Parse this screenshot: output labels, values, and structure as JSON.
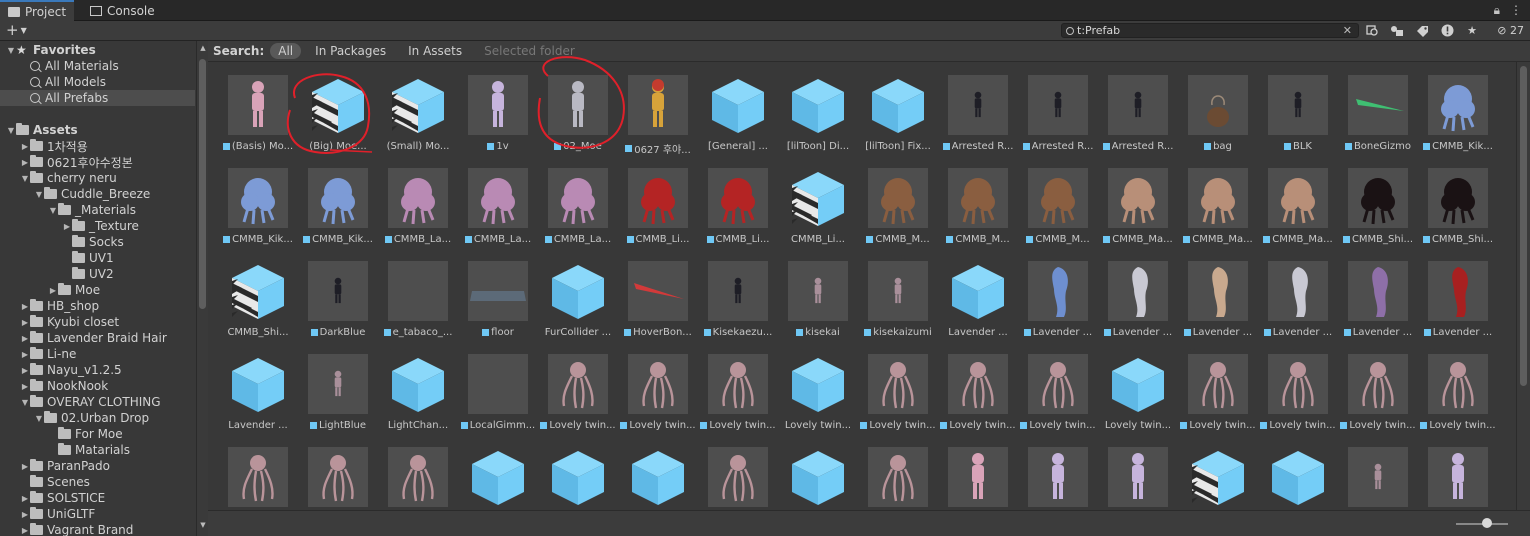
{
  "tabs": [
    {
      "label": "Project",
      "icon": "folder-icon",
      "active": true
    },
    {
      "label": "Console",
      "icon": "console-icon",
      "active": false
    }
  ],
  "toolbar": {
    "add_label": "+",
    "search_value": "t:Prefab",
    "hidden_count": "27"
  },
  "sidebar": {
    "items": [
      {
        "label": "Favorites",
        "depth": 0,
        "expanded": true,
        "kind": "star",
        "bold": true
      },
      {
        "label": "All Materials",
        "depth": 1,
        "kind": "search"
      },
      {
        "label": "All Models",
        "depth": 1,
        "kind": "search"
      },
      {
        "label": "All Prefabs",
        "depth": 1,
        "kind": "search",
        "selected": true
      },
      {
        "label": "Assets",
        "depth": 0,
        "expanded": true,
        "kind": "folder",
        "bold": true
      },
      {
        "label": "1차적용",
        "depth": 1,
        "expanded": false,
        "kind": "folder"
      },
      {
        "label": "0621후야수정본",
        "depth": 1,
        "expanded": false,
        "kind": "folder"
      },
      {
        "label": "cherry neru",
        "depth": 1,
        "expanded": true,
        "kind": "folder"
      },
      {
        "label": "Cuddle_Breeze",
        "depth": 2,
        "expanded": true,
        "kind": "folder"
      },
      {
        "label": "_Materials",
        "depth": 3,
        "expanded": true,
        "kind": "folder"
      },
      {
        "label": "_Texture",
        "depth": 4,
        "expanded": false,
        "kind": "folder"
      },
      {
        "label": "Socks",
        "depth": 4,
        "kind": "folder"
      },
      {
        "label": "UV1",
        "depth": 4,
        "kind": "folder"
      },
      {
        "label": "UV2",
        "depth": 4,
        "kind": "folder"
      },
      {
        "label": "Moe",
        "depth": 3,
        "expanded": false,
        "kind": "folder"
      },
      {
        "label": "HB_shop",
        "depth": 1,
        "expanded": false,
        "kind": "folder"
      },
      {
        "label": "Kyubi closet",
        "depth": 1,
        "expanded": false,
        "kind": "folder"
      },
      {
        "label": "Lavender Braid Hair",
        "depth": 1,
        "expanded": false,
        "kind": "folder"
      },
      {
        "label": "Li-ne",
        "depth": 1,
        "expanded": false,
        "kind": "folder"
      },
      {
        "label": "Nayu_v1.2.5",
        "depth": 1,
        "expanded": false,
        "kind": "folder"
      },
      {
        "label": "NookNook",
        "depth": 1,
        "expanded": false,
        "kind": "folder"
      },
      {
        "label": "OVERAY CLOTHING",
        "depth": 1,
        "expanded": true,
        "kind": "folder"
      },
      {
        "label": "02.Urban Drop",
        "depth": 2,
        "expanded": true,
        "kind": "folder"
      },
      {
        "label": "For Moe",
        "depth": 3,
        "kind": "folder"
      },
      {
        "label": "Matarials",
        "depth": 3,
        "kind": "folder"
      },
      {
        "label": "ParanPado",
        "depth": 1,
        "expanded": false,
        "kind": "folder"
      },
      {
        "label": "Scenes",
        "depth": 1,
        "kind": "folder"
      },
      {
        "label": "SOLSTICE",
        "depth": 1,
        "expanded": false,
        "kind": "folder"
      },
      {
        "label": "UniGLTF",
        "depth": 1,
        "expanded": false,
        "kind": "folder"
      },
      {
        "label": "Vagrant Brand",
        "depth": 1,
        "expanded": false,
        "kind": "folder"
      }
    ]
  },
  "search_bar": {
    "label": "Search:",
    "scopes": [
      {
        "label": "All",
        "active": true
      },
      {
        "label": "In Packages",
        "active": false
      },
      {
        "label": "In Assets",
        "active": false
      },
      {
        "label": "Selected folder",
        "active": false,
        "disabled": true
      }
    ]
  },
  "assets": [
    [
      {
        "label": "(Basis) Mo...",
        "thumb": "figure-pink",
        "prefab_icon": true
      },
      {
        "label": "(Big) Moe...",
        "thumb": "cube-striped",
        "prefab_icon": false
      },
      {
        "label": "(Small) Mo...",
        "thumb": "cube-striped",
        "prefab_icon": false
      },
      {
        "label": "1v",
        "thumb": "figure-lilac",
        "prefab_icon": true
      },
      {
        "label": "02_Moe",
        "thumb": "figure-gray",
        "prefab_icon": true
      },
      {
        "label": "0627 후야...",
        "thumb": "figure-yellow",
        "prefab_icon": true
      },
      {
        "label": "[General] ...",
        "thumb": "cube",
        "prefab_icon": false
      },
      {
        "label": "[lilToon] Di...",
        "thumb": "cube",
        "prefab_icon": false
      },
      {
        "label": "[lilToon] Fix...",
        "thumb": "cube",
        "prefab_icon": false
      },
      {
        "label": "Arrested R...",
        "thumb": "figure-dark",
        "prefab_icon": true
      },
      {
        "label": "Arrested R...",
        "thumb": "figure-dark",
        "prefab_icon": true
      },
      {
        "label": "Arrested R...",
        "thumb": "figure-dark",
        "prefab_icon": true
      },
      {
        "label": "bag",
        "thumb": "bag",
        "prefab_icon": true
      },
      {
        "label": "BLK",
        "thumb": "figure-dark",
        "prefab_icon": true
      },
      {
        "label": "BoneGizmo",
        "thumb": "gizmo-green",
        "prefab_icon": true
      },
      {
        "label": "CMMB_Kik...",
        "thumb": "blob-blue",
        "prefab_icon": true
      }
    ],
    [
      {
        "label": "CMMB_Kik...",
        "thumb": "blob-blue",
        "prefab_icon": true
      },
      {
        "label": "CMMB_Kik...",
        "thumb": "blob-blue",
        "prefab_icon": true
      },
      {
        "label": "CMMB_La...",
        "thumb": "blob-pink",
        "prefab_icon": true
      },
      {
        "label": "CMMB_La...",
        "thumb": "blob-pink",
        "prefab_icon": true
      },
      {
        "label": "CMMB_La...",
        "thumb": "blob-pink",
        "prefab_icon": true
      },
      {
        "label": "CMMB_Li...",
        "thumb": "blob-red",
        "prefab_icon": true
      },
      {
        "label": "CMMB_Li...",
        "thumb": "blob-red",
        "prefab_icon": true
      },
      {
        "label": "CMMB_Li...",
        "thumb": "cube-striped",
        "prefab_icon": false
      },
      {
        "label": "CMMB_M...",
        "thumb": "blob-brown",
        "prefab_icon": true
      },
      {
        "label": "CMMB_M...",
        "thumb": "blob-brown",
        "prefab_icon": true
      },
      {
        "label": "CMMB_M...",
        "thumb": "blob-brown",
        "prefab_icon": true
      },
      {
        "label": "CMMB_Ma...",
        "thumb": "blob-tan",
        "prefab_icon": true
      },
      {
        "label": "CMMB_Ma...",
        "thumb": "blob-tan",
        "prefab_icon": true
      },
      {
        "label": "CMMB_Ma...",
        "thumb": "blob-tan",
        "prefab_icon": true
      },
      {
        "label": "CMMB_Shi...",
        "thumb": "blob-black",
        "prefab_icon": true
      },
      {
        "label": "CMMB_Shi...",
        "thumb": "blob-black",
        "prefab_icon": true
      }
    ],
    [
      {
        "label": "CMMB_Shi...",
        "thumb": "cube-striped",
        "prefab_icon": false
      },
      {
        "label": "DarkBlue",
        "thumb": "figure-dark",
        "prefab_icon": true
      },
      {
        "label": "e_tabaco_...",
        "thumb": "empty",
        "prefab_icon": true
      },
      {
        "label": "floor",
        "thumb": "floor",
        "prefab_icon": true
      },
      {
        "label": "FurCollider ...",
        "thumb": "cube",
        "prefab_icon": false
      },
      {
        "label": "HoverBon...",
        "thumb": "gizmo-red",
        "prefab_icon": true
      },
      {
        "label": "Kisekaezu...",
        "thumb": "figure-dark",
        "prefab_icon": true
      },
      {
        "label": "kisekai",
        "thumb": "figure-small",
        "prefab_icon": true
      },
      {
        "label": "kisekaizumi",
        "thumb": "figure-small",
        "prefab_icon": true
      },
      {
        "label": "Lavender ...",
        "thumb": "cube",
        "prefab_icon": false
      },
      {
        "label": "Lavender ...",
        "thumb": "hair-blue",
        "prefab_icon": true
      },
      {
        "label": "Lavender ...",
        "thumb": "hair-silver",
        "prefab_icon": true
      },
      {
        "label": "Lavender ...",
        "thumb": "hair-tan",
        "prefab_icon": true
      },
      {
        "label": "Lavender ...",
        "thumb": "hair-silver",
        "prefab_icon": true
      },
      {
        "label": "Lavender ...",
        "thumb": "hair-purple",
        "prefab_icon": true
      },
      {
        "label": "Lavender ...",
        "thumb": "hair-red",
        "prefab_icon": true
      }
    ],
    [
      {
        "label": "Lavender ...",
        "thumb": "cube",
        "prefab_icon": false
      },
      {
        "label": "LightBlue",
        "thumb": "figure-small",
        "prefab_icon": true
      },
      {
        "label": "LightChan...",
        "thumb": "cube",
        "prefab_icon": false
      },
      {
        "label": "LocalGimm...",
        "thumb": "empty",
        "prefab_icon": true
      },
      {
        "label": "Lovely twin...",
        "thumb": "tentacle",
        "prefab_icon": true
      },
      {
        "label": "Lovely twin...",
        "thumb": "tentacle",
        "prefab_icon": true
      },
      {
        "label": "Lovely twin...",
        "thumb": "tentacle",
        "prefab_icon": true
      },
      {
        "label": "Lovely twin...",
        "thumb": "cube",
        "prefab_icon": false
      },
      {
        "label": "Lovely twin...",
        "thumb": "tentacle",
        "prefab_icon": true
      },
      {
        "label": "Lovely twin...",
        "thumb": "tentacle",
        "prefab_icon": true
      },
      {
        "label": "Lovely twin...",
        "thumb": "tentacle",
        "prefab_icon": true
      },
      {
        "label": "Lovely twin...",
        "thumb": "cube",
        "prefab_icon": false
      },
      {
        "label": "Lovely twin...",
        "thumb": "tentacle",
        "prefab_icon": true
      },
      {
        "label": "Lovely twin...",
        "thumb": "tentacle",
        "prefab_icon": true
      },
      {
        "label": "Lovely twin...",
        "thumb": "tentacle",
        "prefab_icon": true
      },
      {
        "label": "Lovely twin...",
        "thumb": "tentacle",
        "prefab_icon": true
      }
    ],
    [
      {
        "label": "",
        "thumb": "tentacle",
        "prefab_icon": false
      },
      {
        "label": "",
        "thumb": "tentacle",
        "prefab_icon": false
      },
      {
        "label": "",
        "thumb": "tentacle",
        "prefab_icon": false
      },
      {
        "label": "",
        "thumb": "cube",
        "prefab_icon": false
      },
      {
        "label": "",
        "thumb": "cube",
        "prefab_icon": false
      },
      {
        "label": "",
        "thumb": "cube",
        "prefab_icon": false
      },
      {
        "label": "",
        "thumb": "tentacle",
        "prefab_icon": false
      },
      {
        "label": "",
        "thumb": "cube",
        "prefab_icon": false
      },
      {
        "label": "",
        "thumb": "tentacle",
        "prefab_icon": false
      },
      {
        "label": "",
        "thumb": "figure-pink",
        "prefab_icon": false
      },
      {
        "label": "",
        "thumb": "figure-lilac",
        "prefab_icon": false
      },
      {
        "label": "",
        "thumb": "figure-lilac",
        "prefab_icon": false
      },
      {
        "label": "",
        "thumb": "cube-striped",
        "prefab_icon": false
      },
      {
        "label": "",
        "thumb": "cube",
        "prefab_icon": false
      },
      {
        "label": "",
        "thumb": "figure-small",
        "prefab_icon": false
      },
      {
        "label": "",
        "thumb": "figure-lilac",
        "prefab_icon": false
      }
    ]
  ],
  "colors": {
    "cube_face": "#74cdf7",
    "cube_side": "#5fb9e6",
    "annotation": "#e0202a",
    "tab_accent": "#3a79bb"
  },
  "annotations": [
    {
      "target": "(Big) Moe...",
      "shape": "red-circle"
    },
    {
      "target": "02_Moe",
      "shape": "red-circle"
    }
  ]
}
